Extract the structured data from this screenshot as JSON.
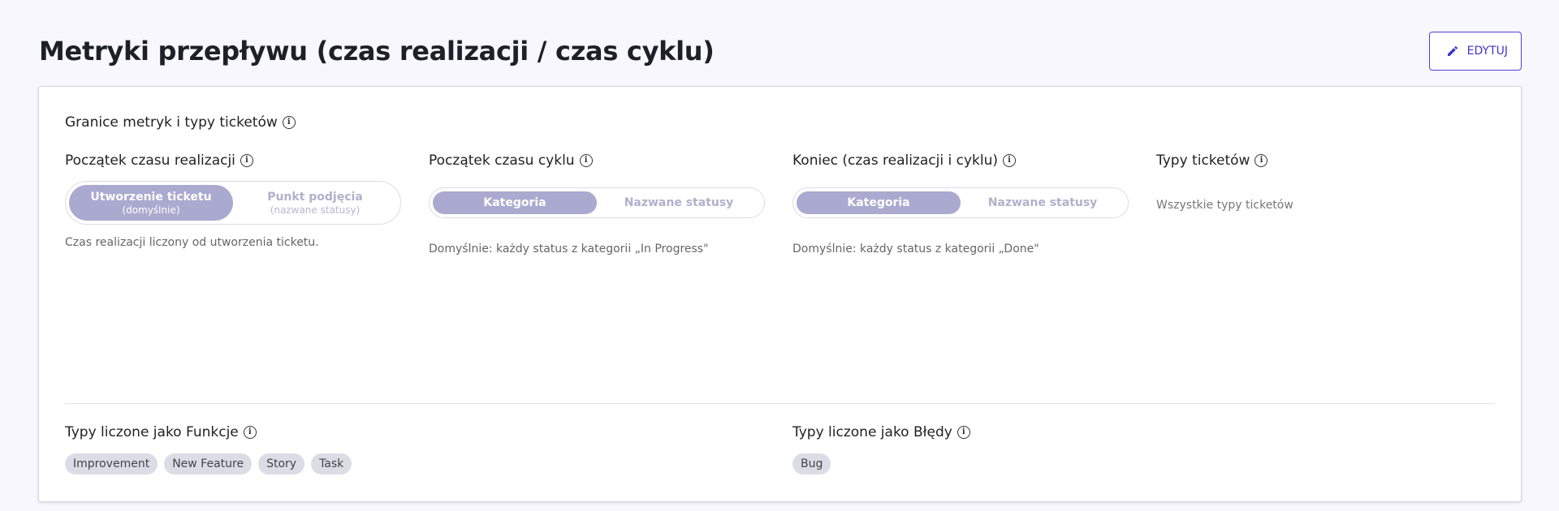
{
  "header": {
    "title": "Metryki przepływu (czas realizacji / czas cyklu)",
    "edit_label": "EDYTUJ"
  },
  "card": {
    "section_title": "Granice metryk i typy ticketów",
    "lead_time_start": {
      "label": "Początek czasu realizacji",
      "option_a": {
        "label": "Utworzenie ticketu",
        "sub": "(domyślnie)",
        "active": true
      },
      "option_b": {
        "label": "Punkt podjęcia",
        "sub": "(nazwane statusy)",
        "active": false
      },
      "description": "Czas realizacji liczony od utworzenia ticketu."
    },
    "cycle_time_start": {
      "label": "Początek czasu cyklu",
      "option_a": {
        "label": "Kategoria",
        "active": true
      },
      "option_b": {
        "label": "Nazwane statusy",
        "active": false
      },
      "description": "Domyślnie: każdy status z kategorii „In Progress\""
    },
    "end": {
      "label": "Koniec (czas realizacji i cyklu)",
      "option_a": {
        "label": "Kategoria",
        "active": true
      },
      "option_b": {
        "label": "Nazwane statusy",
        "active": false
      },
      "description": "Domyślnie: każdy status z kategorii „Done\""
    },
    "ticket_types": {
      "label": "Typy ticketów",
      "value": "Wszystkie typy ticketów"
    },
    "features": {
      "label": "Typy liczone jako Funkcje",
      "tags": [
        "Improvement",
        "New Feature",
        "Story",
        "Task"
      ]
    },
    "bugs": {
      "label": "Typy liczone jako Błędy",
      "tags": [
        "Bug"
      ]
    }
  },
  "colors": {
    "accent": "#4b41d6",
    "toggle_active": "#aaa9cf",
    "tag_bg": "#dcdce6"
  }
}
